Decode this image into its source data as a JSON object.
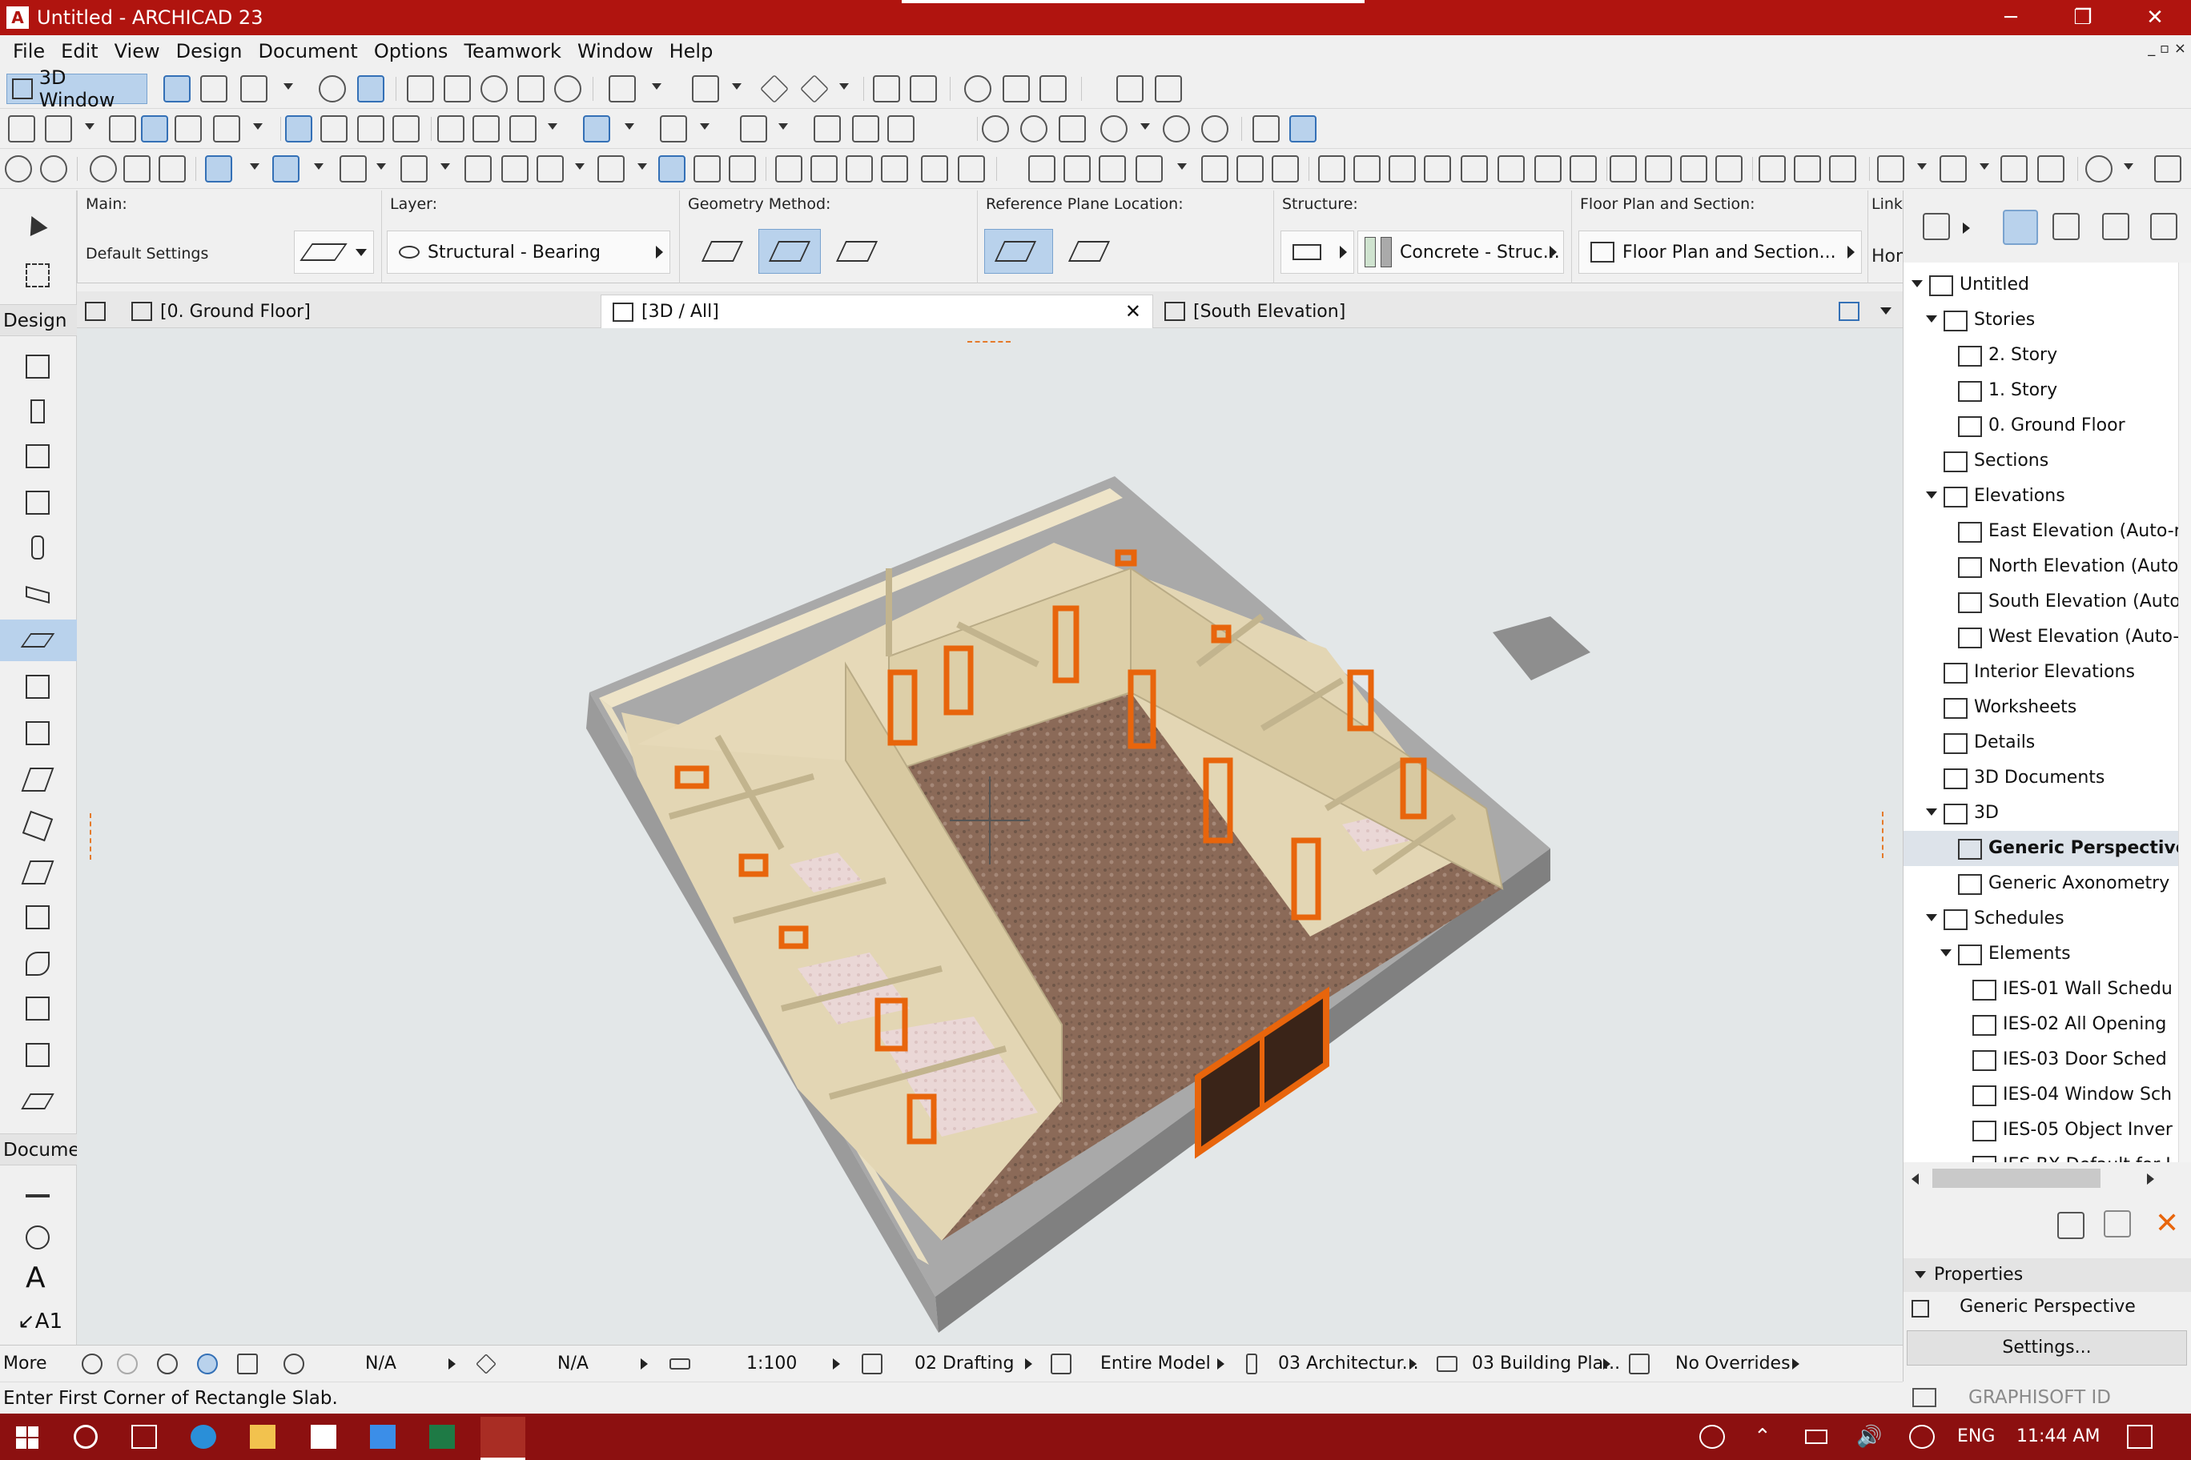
{
  "window": {
    "title": "Untitled - ARCHICAD 23",
    "minimize": "─",
    "restore": "❐",
    "close": "✕",
    "mdi_controls": "_ ▫ ×"
  },
  "menu": [
    "File",
    "Edit",
    "View",
    "Design",
    "Document",
    "Options",
    "Teamwork",
    "Window",
    "Help"
  ],
  "toolbar": {
    "window_button": "3D Window"
  },
  "infobox": {
    "main": {
      "label": "Main:",
      "value": "Default Settings"
    },
    "layer": {
      "label": "Layer:",
      "value": "Structural - Bearing"
    },
    "geometry": {
      "label": "Geometry Method:"
    },
    "reference": {
      "label": "Reference Plane Location:"
    },
    "structure": {
      "label": "Structure:",
      "value": "Concrete - Struc..."
    },
    "floorplan": {
      "label": "Floor Plan and Section:",
      "value": "Floor Plan and Section..."
    },
    "linked": {
      "label": "Linke",
      "value": "Hom"
    }
  },
  "toolbox": {
    "design_header": "Design",
    "document_header": "Documer",
    "more": "More",
    "design_tools": [
      "wall-tool",
      "column-tool",
      "door-tool",
      "window-tool",
      "beam-tool",
      "roof-tool",
      "slab-tool",
      "stair-tool",
      "railing-tool",
      "shell-tool",
      "morph-tool",
      "mesh-tool",
      "curtain-wall-tool",
      "object-tool",
      "zone-tool",
      "skylight-tool",
      "lamp-tool"
    ],
    "document_tools": [
      "dimension-tool",
      "level-dimension-tool",
      "text-tool",
      "label-tool"
    ]
  },
  "tabs": [
    {
      "label": "[0. Ground Floor]",
      "active": false
    },
    {
      "label": "[3D / All]",
      "active": true
    },
    {
      "label": "[South Elevation]",
      "active": false
    }
  ],
  "tab_close": "✕",
  "statusbar": {
    "zoom1": "N/A",
    "zoom2": "N/A",
    "scale": "1:100",
    "layer_combo": "02 Drafting",
    "model_view": "Entire Model",
    "pen_set": "03 Architectur...",
    "mvo": "03 Building Pla...",
    "overrides": "No Overrides"
  },
  "message": "Enter First Corner of Rectangle Slab.",
  "navigator": {
    "tree": [
      {
        "label": "Untitled",
        "level": 0,
        "expanded": true
      },
      {
        "label": "Stories",
        "level": 1,
        "expanded": true
      },
      {
        "label": "2. Story",
        "level": 2
      },
      {
        "label": "1. Story",
        "level": 2
      },
      {
        "label": "0. Ground Floor",
        "level": 2
      },
      {
        "label": "Sections",
        "level": 1
      },
      {
        "label": "Elevations",
        "level": 1,
        "expanded": true
      },
      {
        "label": "East Elevation (Auto-r",
        "level": 2
      },
      {
        "label": "North Elevation (Auto",
        "level": 2
      },
      {
        "label": "South Elevation (Auto",
        "level": 2
      },
      {
        "label": "West Elevation (Auto-",
        "level": 2
      },
      {
        "label": "Interior Elevations",
        "level": 1
      },
      {
        "label": "Worksheets",
        "level": 1
      },
      {
        "label": "Details",
        "level": 1
      },
      {
        "label": "3D Documents",
        "level": 1
      },
      {
        "label": "3D",
        "level": 1,
        "expanded": true
      },
      {
        "label": "Generic Perspective",
        "level": 2,
        "selected": true
      },
      {
        "label": "Generic Axonometry",
        "level": 2
      },
      {
        "label": "Schedules",
        "level": 1,
        "expanded": true
      },
      {
        "label": "Elements",
        "level": 2,
        "expanded": true
      },
      {
        "label": "IES-01 Wall Schedu",
        "level": 3
      },
      {
        "label": "IES-02 All Opening",
        "level": 3
      },
      {
        "label": "IES-03 Door Sched",
        "level": 3
      },
      {
        "label": "IES-04 Window Sch",
        "level": 3
      },
      {
        "label": "IES-05 Object Inver",
        "level": 3
      },
      {
        "label": "IES-BX Default for I",
        "level": 3
      }
    ]
  },
  "properties": {
    "header": "Properties",
    "view_name": "Generic Perspective",
    "settings_button": "Settings..."
  },
  "brand": "GRAPHISOFT ID",
  "taskbar": {
    "language": "ENG",
    "time": "11:44 AM"
  },
  "colors": {
    "titlebar": "#b0140f",
    "taskbar": "#8c1010",
    "selection": "#b9d2ec",
    "door_frame": "#e8650c",
    "wall": "#e3d6b4",
    "floor_brown": "#8b6a58"
  }
}
